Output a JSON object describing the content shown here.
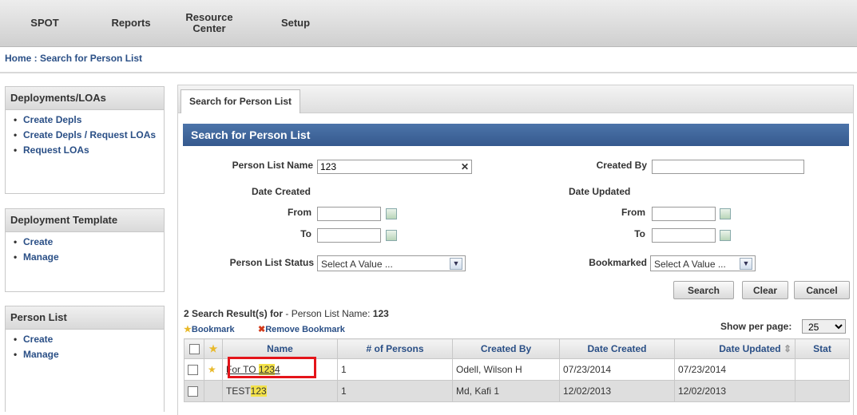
{
  "nav": {
    "items": [
      "SPOT",
      "Reports",
      "Resource Center",
      "Setup"
    ]
  },
  "breadcrumb": {
    "home": "Home",
    "sep": " : ",
    "current": "Search for Person List"
  },
  "sidebar": {
    "deployments": {
      "title": "Deployments/LOAs",
      "items": [
        "Create Depls",
        "Create Depls / Request LOAs",
        "Request LOAs"
      ]
    },
    "template": {
      "title": "Deployment Template",
      "items": [
        "Create",
        "Manage"
      ]
    },
    "personlist": {
      "title": "Person List",
      "items": [
        "Create",
        "Manage"
      ]
    }
  },
  "main": {
    "tab": "Search for Person List",
    "title": "Search for Person List",
    "form": {
      "person_list_name_label": "Person List Name",
      "person_list_name_value": "123",
      "created_by_label": "Created By",
      "date_created_label": "Date Created",
      "date_updated_label": "Date Updated",
      "from_label": "From",
      "to_label": "To",
      "status_label": "Person List Status",
      "status_value": "Select A Value ...",
      "bookmarked_label": "Bookmarked",
      "bookmarked_value": "Select A Value ..."
    },
    "buttons": {
      "search": "Search",
      "clear": "Clear",
      "cancel": "Cancel"
    },
    "results": {
      "summary": "2 Search Result(s) for",
      "criteria": " - Person List Name: ",
      "criteria_value": "123",
      "bookmark": "Bookmark",
      "remove_bookmark": "Remove Bookmark",
      "show_per_page_label": "Show per page:",
      "per_page_value": "25"
    },
    "table": {
      "headers": [
        "Name",
        "# of Persons",
        "Created By",
        "Date Created",
        "Date Updated",
        "Stat"
      ],
      "rows": [
        {
          "name_prefix": "For TO ",
          "name_highlight": "123",
          "name_suffix": "4",
          "persons": "1",
          "created_by": "Odell, Wilson H",
          "date_created": "07/23/2014",
          "date_updated": "07/23/2014"
        },
        {
          "name_prefix": "TEST",
          "name_highlight": "123",
          "name_suffix": "",
          "persons": "1",
          "created_by": "Md, Kafi 1",
          "date_created": "12/02/2013",
          "date_updated": "12/02/2013"
        }
      ]
    }
  },
  "colors": {
    "accent": "#35598e",
    "link": "#2a4f86",
    "highlight": "#f3e24a",
    "callout": "#e4141a"
  }
}
